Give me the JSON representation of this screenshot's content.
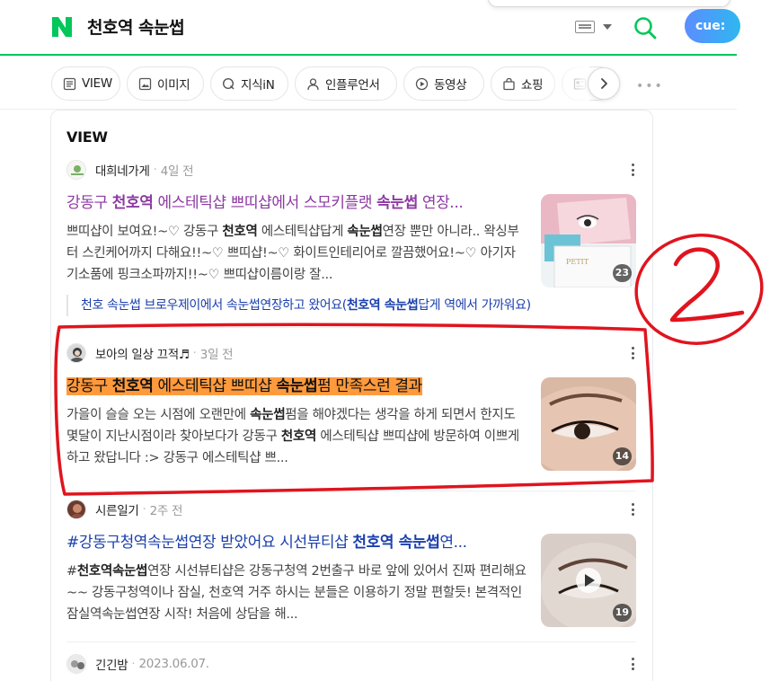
{
  "header": {
    "logo_letter": "N",
    "query": "천호역 속눈썹",
    "keyboard_icon": "keyboard-icon",
    "search_icon": "search-icon",
    "cue_label": "cue:",
    "brand_color": "#03c75a"
  },
  "tabs": [
    {
      "label": "VIEW",
      "icon": "document-icon"
    },
    {
      "label": "이미지",
      "icon": "image-icon"
    },
    {
      "label": "지식iN",
      "icon": "q-icon"
    },
    {
      "label": "인플루언서",
      "icon": "person-icon"
    },
    {
      "label": "동영상",
      "icon": "play-icon"
    },
    {
      "label": "쇼핑",
      "icon": "bag-icon"
    },
    {
      "label": "",
      "icon": "news-icon"
    }
  ],
  "section": {
    "title": "VIEW"
  },
  "posts": [
    {
      "author": "대희네가게",
      "date": "4일 전",
      "title_parts": [
        "강동구 ",
        "천호역",
        " 에스테틱샵 쁘띠샵에서 스모키플랫 ",
        "속눈썹",
        " 연장..."
      ],
      "body_parts": [
        "쁘띠샵이 보여요!~♡ 강동구 ",
        "천호역",
        " 에스테틱샵답게 ",
        "속눈썹",
        "연장 뿐만 아니라.. 왁싱부터 스킨케어까지 다해요!!~♡ 쁘띠샵!~♡ 화이트인테리어로 깔끔했어요!~♡ 아기자기소품에 핑크소파까지!!~♡ 쁘띠샵이름이랑 잘..."
      ],
      "image_count": "23",
      "related_parts": [
        "천호 속눈썹 브로우제이에서 속눈썹연장하고 왔어요(",
        "천호역 속눈썹",
        "답게 역에서 가까워요)"
      ]
    },
    {
      "author": "보아의 일상 끄적♬",
      "date": "3일 전",
      "title_parts": [
        "강동구 ",
        "천호역",
        " 에스테틱샵 쁘띠샵 ",
        "속눈썹",
        "펌 만족스런 결과"
      ],
      "body_parts": [
        "가을이 슬슬 오는 시점에 오랜만에 ",
        "속눈썹",
        "펌을 해야겠다는 생각을 하게 되면서 한지도 몇달이 지난시점이라 찾아보다가 강동구 ",
        "천호역",
        " 에스테틱샵 쁘띠샵에 방문하여 이쁘게 하고 왔답니다 :> 강동구 에스테틱샵 쁘..."
      ],
      "image_count": "14"
    },
    {
      "author": "시른일기",
      "date": "2주 전",
      "title_parts": [
        "#강동구청역속눈썹연장 받았어요 시선뷰티샵 ",
        "천호역 속눈썹",
        "연..."
      ],
      "body_parts": [
        "#",
        "천호역속눈썹",
        "연장 시선뷰티샵은 강동구청역 2번출구 바로 앞에 있어서 진짜 편리해요~~ 강동구청역이나 잠실, 천호역 거주 하시는 분들은 이용하기 정말 편할듯! 본격적인 잠실역속눈썹연장 시작! 처음에 상담을 해..."
      ],
      "image_count": "19"
    },
    {
      "author": "긴긴밤",
      "date": "2023.06.07."
    }
  ],
  "annotation": {
    "label": "2",
    "color": "#e0141e"
  }
}
